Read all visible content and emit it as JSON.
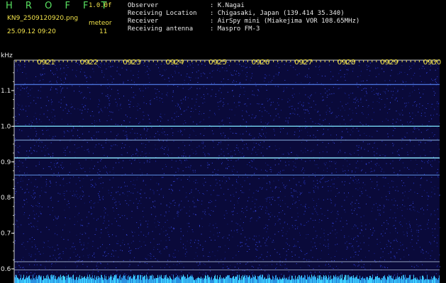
{
  "header": {
    "brand": "H R O F F T",
    "version": "1.0.0f",
    "filename": "KN9_2509120920.png",
    "unit_label": "meteor",
    "datetime": "25.09.12 09:20",
    "count": "11"
  },
  "meta": [
    {
      "key": "Observer",
      "value": ": K.Nagai"
    },
    {
      "key": "Receiving Location",
      "value": ": Chigasaki, Japan (139.414 35.340)"
    },
    {
      "key": "Receiver",
      "value": ": AirSpy mini (Miakejima VOR 108.65MHz)"
    },
    {
      "key": "Receiving antenna",
      "value": ": Maspro FM-3"
    }
  ],
  "axis": {
    "y_unit": "kHz",
    "y_ticks": [
      "1.1",
      "1.0",
      "0.9",
      "0.8",
      "0.7",
      "0.6"
    ],
    "x_ticks": [
      "0921",
      "0922",
      "0923",
      "0924",
      "0925",
      "0926",
      "0927",
      "0928",
      "0929",
      "0930"
    ]
  },
  "colors": {
    "background": "#0a0a3a",
    "noise": "#2a3ad0",
    "signal": "#7fe8ff",
    "header_text": "#f0e14a",
    "brand": "#58e060"
  }
}
